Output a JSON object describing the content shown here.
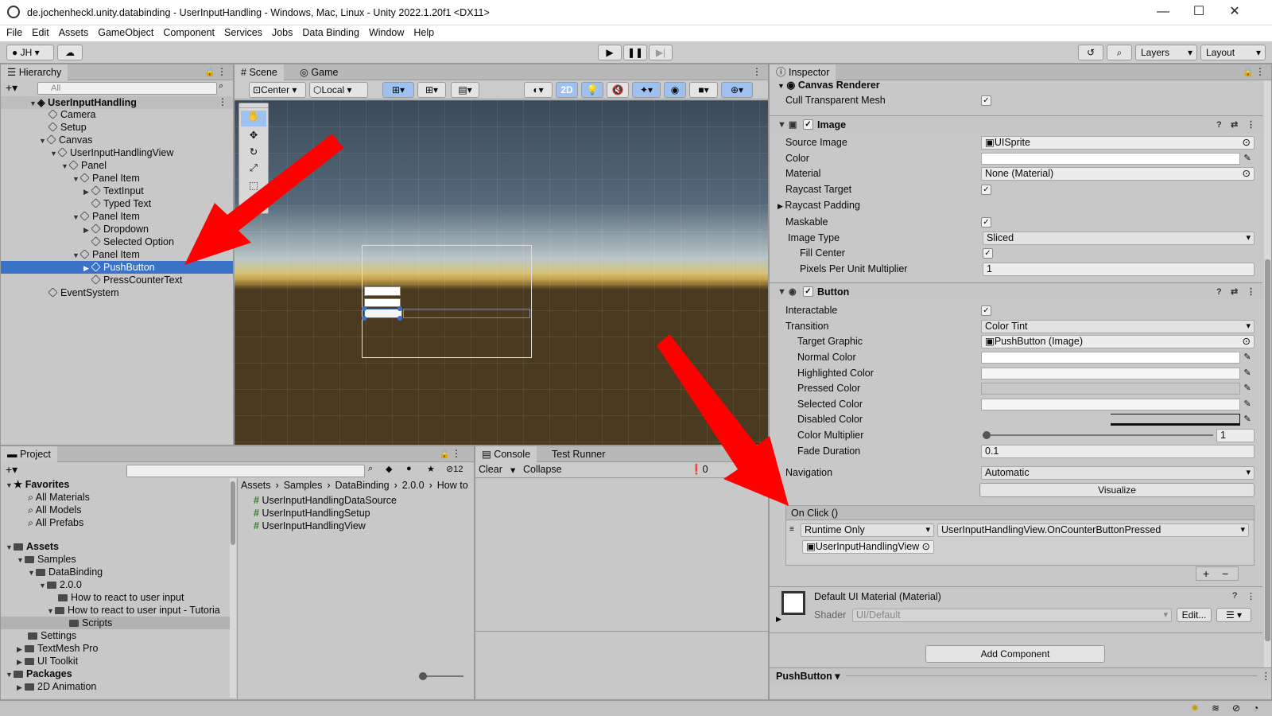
{
  "window": {
    "title": "de.jochenheckl.unity.databinding - UserInputHandling - Windows, Mac, Linux - Unity 2022.1.20f1 <DX11>",
    "minimize": "—",
    "maximize": "☐",
    "close": "✕"
  },
  "menu": [
    "File",
    "Edit",
    "Assets",
    "GameObject",
    "Component",
    "Services",
    "Jobs",
    "Data Binding",
    "Window",
    "Help"
  ],
  "toolbar": {
    "account": "JH",
    "layers": "Layers",
    "layout": "Layout"
  },
  "hierarchy": {
    "tab": "Hierarchy",
    "search_placeholder": "All",
    "items": [
      {
        "label": "UserInputHandling"
      },
      {
        "label": "Camera"
      },
      {
        "label": "Setup"
      },
      {
        "label": "Canvas"
      },
      {
        "label": "UserInputHandlingView"
      },
      {
        "label": "Panel"
      },
      {
        "label": "Panel Item"
      },
      {
        "label": "TextInput"
      },
      {
        "label": "Typed Text"
      },
      {
        "label": "Panel Item"
      },
      {
        "label": "Dropdown"
      },
      {
        "label": "Selected Option"
      },
      {
        "label": "Panel Item"
      },
      {
        "label": "PushButton"
      },
      {
        "label": "PressCounterText"
      },
      {
        "label": "EventSystem"
      }
    ]
  },
  "scene": {
    "tabs": [
      "Scene",
      "Game"
    ],
    "pivot": "Center",
    "space": "Local",
    "mode2d": "2D"
  },
  "inspector": {
    "tab": "Inspector",
    "canvas_renderer": {
      "title": "Canvas Renderer",
      "cull_label": "Cull Transparent Mesh"
    },
    "image": {
      "title": "Image",
      "source_image_label": "Source Image",
      "source_image_value": "UISprite",
      "color_label": "Color",
      "material_label": "Material",
      "material_value": "None (Material)",
      "raycast_target_label": "Raycast Target",
      "raycast_padding_label": "Raycast Padding",
      "maskable_label": "Maskable",
      "image_type_label": "Image Type",
      "image_type_value": "Sliced",
      "fill_center_label": "Fill Center",
      "ppu_label": "Pixels Per Unit Multiplier",
      "ppu_value": "1"
    },
    "button": {
      "title": "Button",
      "interactable_label": "Interactable",
      "transition_label": "Transition",
      "transition_value": "Color Tint",
      "target_graphic_label": "Target Graphic",
      "target_graphic_value": "PushButton (Image)",
      "normal_label": "Normal Color",
      "highlighted_label": "Highlighted Color",
      "pressed_label": "Pressed Color",
      "selected_label": "Selected Color",
      "disabled_label": "Disabled Color",
      "multiplier_label": "Color Multiplier",
      "multiplier_value": "1",
      "multiplier_slider": 0.0,
      "fade_label": "Fade Duration",
      "fade_value": "0.1",
      "navigation_label": "Navigation",
      "navigation_value": "Automatic",
      "visualize_label": "Visualize"
    },
    "onclick": {
      "header": "On Click ()",
      "runtime": "Runtime Only",
      "function": "UserInputHandlingView.OnCounterButtonPressed",
      "target": "UserInputHandlingView",
      "plus": "+",
      "minus": "−"
    },
    "material": {
      "title": "Default UI Material (Material)",
      "shader_label": "Shader",
      "shader_value": "UI/Default",
      "edit_label": "Edit..."
    },
    "add_component": "Add Component",
    "footer": "PushButton"
  },
  "project": {
    "tab": "Project",
    "count": "12",
    "favorites": "Favorites",
    "fav_items": [
      "All Materials",
      "All Models",
      "All Prefabs"
    ],
    "assets": "Assets",
    "tree": [
      "Samples",
      "DataBinding",
      "2.0.0",
      "How to react to user input",
      "How to react to user input - Tutoria",
      "Scripts",
      "Settings",
      "TextMesh Pro",
      "UI Toolkit"
    ],
    "packages": "Packages",
    "packages_items": [
      "2D Animation"
    ],
    "breadcrumb": [
      "Assets",
      "Samples",
      "DataBinding",
      "2.0.0",
      "How to"
    ],
    "files": [
      "UserInputHandlingDataSource",
      "UserInputHandlingSetup",
      "UserInputHandlingView"
    ]
  },
  "console": {
    "tabs": [
      "Console",
      "Test Runner"
    ],
    "clear": "Clear",
    "collapse": "Collapse",
    "errors": "0"
  },
  "colors": {
    "selection": "#3a72c8",
    "arrow": "#ff0000",
    "sky_top": "#3f4f5e",
    "ground": "#4a3a1f"
  }
}
